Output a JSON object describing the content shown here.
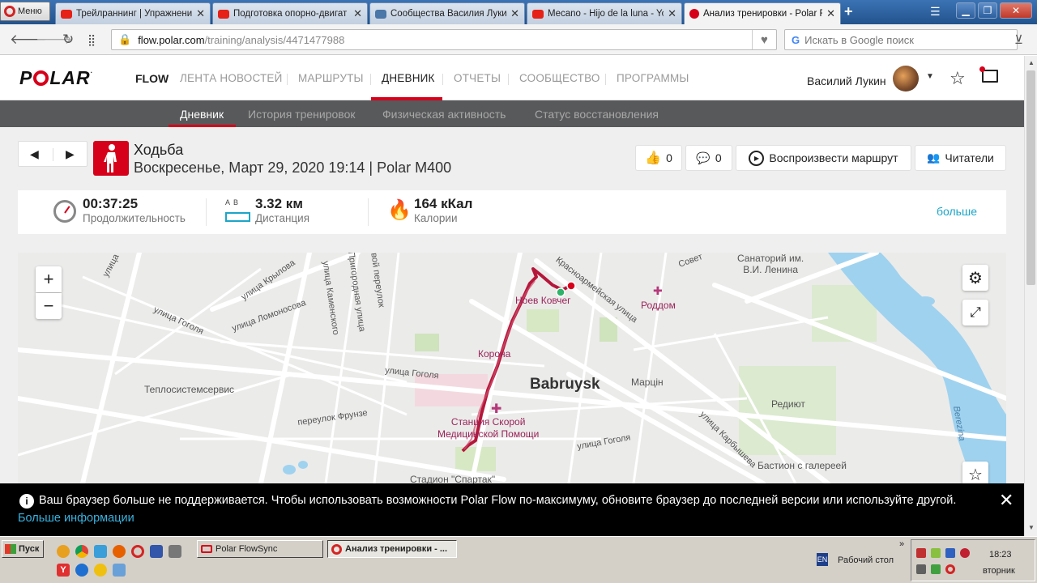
{
  "browser": {
    "menu_label": "Меню",
    "tabs": [
      {
        "title": "Трейлраннинг | Упражнени",
        "color": "#e62117"
      },
      {
        "title": "Подготовка опорно-двигат",
        "color": "#e62117"
      },
      {
        "title": "Сообщества Василия Лукин",
        "color": "#4a76a8"
      },
      {
        "title": "Mecano - Hijo de la luna - You",
        "color": "#e62117"
      },
      {
        "title": "Анализ тренировки - Polar F",
        "color": "#d7001a"
      }
    ],
    "url_domain": "flow.polar.com",
    "url_path": "/training/analysis/4471477988",
    "search_placeholder": "Искать в Google поиск"
  },
  "polar": {
    "flow_label": "FLOW",
    "nav": [
      "ЛЕНТА НОВОСТЕЙ",
      "МАРШРУТЫ",
      "ДНЕВНИК",
      "ОТЧЕТЫ",
      "СООБЩЕСТВО",
      "ПРОГРАММЫ"
    ],
    "user_name": "Василий Лукин",
    "subnav": [
      "Дневник",
      "История тренировок",
      "Физическая активность",
      "Статус восстановления"
    ]
  },
  "workout": {
    "sport": "Ходьба",
    "datetime": "Воскресенье, Март 29, 2020 19:14 | Polar M400",
    "likes": "0",
    "comments": "0",
    "replay_label": "Воспроизвести маршрут",
    "followers_label": "Читатели",
    "duration_value": "00:37:25",
    "duration_label": "Продолжительность",
    "distance_ab": "A  B",
    "distance_value": "3.32 км",
    "distance_label": "Дистанция",
    "calories_value": "164 кКал",
    "calories_label": "Калории",
    "more_label": "больше"
  },
  "map": {
    "zoom_in": "+",
    "zoom_out": "−",
    "labels": {
      "krylova": "улица Крылова",
      "lomonosova": "улица Ломоносова",
      "gogolya_w": "улица Гоголя",
      "kamenskogo": "улица Каменского",
      "prigorodnaya": "Пригородная улица",
      "tupoy": "вой переулок",
      "krasnoarm": "Красноармейская улица",
      "gogolya_c": "улица Гоголя",
      "gogolya_s": "улица Гоголя",
      "frunze": "переулок Фрунзе",
      "karbysheva": "улица Карбышева",
      "ulitsa_nw": "улица",
      "sovetskaya": "Совет",
      "sanatorium": "Санаторий им.\nВ.И. Ленина",
      "kovcheg": "Ноев Ковчег",
      "rodom": "Роддом",
      "korona": "Корона",
      "teplo": "Теплосистемсервис",
      "city": "Babruysk",
      "martsin": "Марцін",
      "redut": "Редиют",
      "skoraya": "Станция Скорой\nМедицинской Помощи",
      "stadium": "Стадион \"Спартак\"",
      "bastion": "Бастион с галереей",
      "berezina": "Berezina"
    }
  },
  "banner": {
    "message": "Ваш браузер больше не поддерживается. Чтобы использовать возможности Polar Flow по-максимуму, обновите браузер до последней версии или используйте другой.",
    "more_info": "Больше информации"
  },
  "taskbar": {
    "start_label": "Пуск",
    "tasks": [
      "Polar FlowSync",
      "Анализ тренировки - ..."
    ],
    "lang": "EN",
    "desktop_label": "Рабочий стол",
    "time": "18:23",
    "day": "вторник"
  }
}
